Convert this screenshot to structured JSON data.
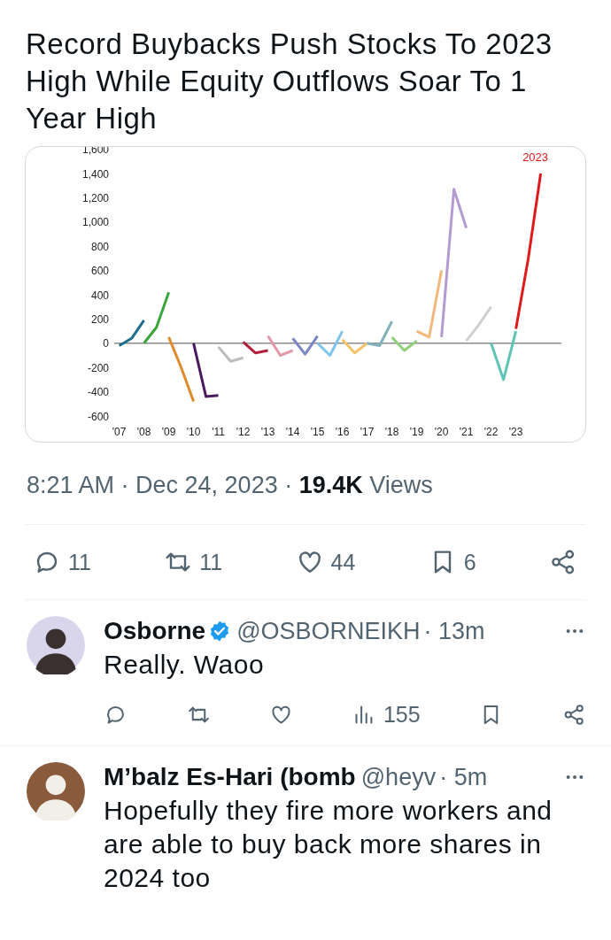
{
  "post": {
    "title": "Record Buybacks Push Stocks To 2023 High While Equity Outflows Soar To 1 Year High",
    "chart": {
      "chart_data": {
        "type": "line",
        "x": [
          2007,
          2007.5,
          2008,
          2008.5,
          2009,
          2009.5,
          2010,
          2010.5,
          2011,
          2011.5,
          2012,
          2012.5,
          2013,
          2013.5,
          2014,
          2014.5,
          2015,
          2015.5,
          2016,
          2016.5,
          2017,
          2017.5,
          2018,
          2018.5,
          2019,
          2019.5,
          2020,
          2020.5,
          2021,
          2021.5,
          2022,
          2022.5,
          2023,
          2023.5,
          2024
        ],
        "xlim": [
          2006.8,
          2024.8
        ],
        "xticks": [
          {
            "value": 2007,
            "label": "'07"
          },
          {
            "value": 2008,
            "label": "'08"
          },
          {
            "value": 2009,
            "label": "'09"
          },
          {
            "value": 2010,
            "label": "'10"
          },
          {
            "value": 2011,
            "label": "'11"
          },
          {
            "value": 2012,
            "label": "'12"
          },
          {
            "value": 2013,
            "label": "'13"
          },
          {
            "value": 2014,
            "label": "'14"
          },
          {
            "value": 2015,
            "label": "'15"
          },
          {
            "value": 2016,
            "label": "'16"
          },
          {
            "value": 2017,
            "label": "'17"
          },
          {
            "value": 2018,
            "label": "'18"
          },
          {
            "value": 2019,
            "label": "'19"
          },
          {
            "value": 2020,
            "label": "'20"
          },
          {
            "value": 2021,
            "label": "'21"
          },
          {
            "value": 2022,
            "label": "'22"
          },
          {
            "value": 2023,
            "label": "'23"
          }
        ],
        "ylim": [
          -600,
          1600
        ],
        "yticks": [
          {
            "value": 1600,
            "label": "1,600"
          },
          {
            "value": 1400,
            "label": "1,400"
          },
          {
            "value": 1200,
            "label": "1,200"
          },
          {
            "value": 1000,
            "label": "1,000"
          },
          800,
          600,
          400,
          200,
          0,
          -200,
          -400,
          -600
        ],
        "series": [
          {
            "color": "#1f6f8b",
            "values": [
              -20,
              40,
              190,
              null,
              null,
              null,
              null,
              null,
              null,
              null,
              null,
              null,
              null,
              null,
              null,
              null,
              null,
              null,
              null,
              null,
              null,
              null,
              null,
              null,
              null,
              null,
              null,
              null,
              null,
              null,
              null,
              null,
              null,
              null,
              null
            ]
          },
          {
            "color": "#3aa53a",
            "values": [
              null,
              null,
              0,
              130,
              420,
              null,
              null,
              null,
              null,
              null,
              null,
              null,
              null,
              null,
              null,
              null,
              null,
              null,
              null,
              null,
              null,
              null,
              null,
              null,
              null,
              null,
              null,
              null,
              null,
              null,
              null,
              null,
              null,
              null,
              null
            ]
          },
          {
            "color": "#e08a2c",
            "values": [
              null,
              null,
              null,
              null,
              50,
              -200,
              -480,
              null,
              null,
              null,
              null,
              null,
              null,
              null,
              null,
              null,
              null,
              null,
              null,
              null,
              null,
              null,
              null,
              null,
              null,
              null,
              null,
              null,
              null,
              null,
              null,
              null,
              null,
              null,
              null
            ]
          },
          {
            "color": "#4b1a5e",
            "values": [
              null,
              null,
              null,
              null,
              null,
              null,
              0,
              -440,
              -430,
              null,
              null,
              null,
              null,
              null,
              null,
              null,
              null,
              null,
              null,
              null,
              null,
              null,
              null,
              null,
              null,
              null,
              null,
              null,
              null,
              null,
              null,
              null,
              null,
              null,
              null
            ]
          },
          {
            "color": "#bdbdbd",
            "values": [
              null,
              null,
              null,
              null,
              null,
              null,
              null,
              null,
              -30,
              -150,
              -120,
              null,
              null,
              null,
              null,
              null,
              null,
              null,
              null,
              null,
              null,
              null,
              null,
              null,
              null,
              null,
              null,
              null,
              null,
              null,
              null,
              null,
              null,
              null,
              null
            ]
          },
          {
            "color": "#b0203a",
            "values": [
              null,
              null,
              null,
              null,
              null,
              null,
              null,
              null,
              null,
              null,
              10,
              -80,
              -60,
              null,
              null,
              null,
              null,
              null,
              null,
              null,
              null,
              null,
              null,
              null,
              null,
              null,
              null,
              null,
              null,
              null,
              null,
              null,
              null,
              null,
              null
            ]
          },
          {
            "color": "#e39aa8",
            "values": [
              null,
              null,
              null,
              null,
              null,
              null,
              null,
              null,
              null,
              null,
              null,
              null,
              60,
              -100,
              -60,
              null,
              null,
              null,
              null,
              null,
              null,
              null,
              null,
              null,
              null,
              null,
              null,
              null,
              null,
              null,
              null,
              null,
              null,
              null,
              null
            ]
          },
          {
            "color": "#7b86c2",
            "values": [
              null,
              null,
              null,
              null,
              null,
              null,
              null,
              null,
              null,
              null,
              null,
              null,
              null,
              null,
              40,
              -90,
              60,
              null,
              null,
              null,
              null,
              null,
              null,
              null,
              null,
              null,
              null,
              null,
              null,
              null,
              null,
              null,
              null,
              null,
              null
            ]
          },
          {
            "color": "#7fc4ea",
            "values": [
              null,
              null,
              null,
              null,
              null,
              null,
              null,
              null,
              null,
              null,
              null,
              null,
              null,
              null,
              null,
              null,
              0,
              -100,
              100,
              null,
              null,
              null,
              null,
              null,
              null,
              null,
              null,
              null,
              null,
              null,
              null,
              null,
              null,
              null,
              null
            ]
          },
          {
            "color": "#f2c46a",
            "values": [
              null,
              null,
              null,
              null,
              null,
              null,
              null,
              null,
              null,
              null,
              null,
              null,
              null,
              null,
              null,
              null,
              null,
              null,
              30,
              -80,
              0,
              null,
              null,
              null,
              null,
              null,
              null,
              null,
              null,
              null,
              null,
              null,
              null,
              null,
              null
            ]
          },
          {
            "color": "#7fb0ba",
            "values": [
              null,
              null,
              null,
              null,
              null,
              null,
              null,
              null,
              null,
              null,
              null,
              null,
              null,
              null,
              null,
              null,
              null,
              null,
              null,
              null,
              0,
              -20,
              180,
              null,
              null,
              null,
              null,
              null,
              null,
              null,
              null,
              null,
              null,
              null,
              null
            ]
          },
          {
            "color": "#8fce7a",
            "values": [
              null,
              null,
              null,
              null,
              null,
              null,
              null,
              null,
              null,
              null,
              null,
              null,
              null,
              null,
              null,
              null,
              null,
              null,
              null,
              null,
              null,
              null,
              50,
              -60,
              20,
              null,
              null,
              null,
              null,
              null,
              null,
              null,
              null,
              null,
              null
            ]
          },
          {
            "color": "#f2b77a",
            "values": [
              null,
              null,
              null,
              null,
              null,
              null,
              null,
              null,
              null,
              null,
              null,
              null,
              null,
              null,
              null,
              null,
              null,
              null,
              null,
              null,
              null,
              null,
              null,
              null,
              100,
              50,
              600,
              null,
              null,
              null,
              null,
              null,
              null,
              null,
              null
            ]
          },
          {
            "color": "#b39ad1",
            "values": [
              null,
              null,
              null,
              null,
              null,
              null,
              null,
              null,
              null,
              null,
              null,
              null,
              null,
              null,
              null,
              null,
              null,
              null,
              null,
              null,
              null,
              null,
              null,
              null,
              null,
              null,
              50,
              1270,
              950,
              null,
              null,
              null,
              null,
              null,
              null
            ]
          },
          {
            "color": "#cfcfcf",
            "values": [
              null,
              null,
              null,
              null,
              null,
              null,
              null,
              null,
              null,
              null,
              null,
              null,
              null,
              null,
              null,
              null,
              null,
              null,
              null,
              null,
              null,
              null,
              null,
              null,
              null,
              null,
              null,
              null,
              20,
              150,
              300,
              null,
              null,
              null,
              null
            ]
          },
          {
            "color": "#5fc4b4",
            "values": [
              null,
              null,
              null,
              null,
              null,
              null,
              null,
              null,
              null,
              null,
              null,
              null,
              null,
              null,
              null,
              null,
              null,
              null,
              null,
              null,
              null,
              null,
              null,
              null,
              null,
              null,
              null,
              null,
              null,
              null,
              0,
              -300,
              100,
              null,
              null
            ]
          },
          {
            "name": "2023",
            "color": "#e01a1a",
            "values": [
              null,
              null,
              null,
              null,
              null,
              null,
              null,
              null,
              null,
              null,
              null,
              null,
              null,
              null,
              null,
              null,
              null,
              null,
              null,
              null,
              null,
              null,
              null,
              null,
              null,
              null,
              null,
              null,
              null,
              null,
              null,
              null,
              120,
              700,
              1400
            ]
          }
        ]
      }
    },
    "meta": "8:21 AM · Dec 24, 2023 · **19.4K** Views",
    "actions": [
      {
        "kind": "reply",
        "count": "11"
      },
      {
        "kind": "repost",
        "count": "11"
      },
      {
        "kind": "like",
        "count": "44"
      },
      {
        "kind": "bookmark",
        "count": "6"
      },
      {
        "kind": "share"
      }
    ]
  },
  "replies": [
    {
      "name": "Osborne",
      "verified": true,
      "handle": "@OSBORNEIKH",
      "time": "· 13m",
      "text": "Really. Waoo",
      "actions": [
        {
          "kind": "reply"
        },
        {
          "kind": "repost"
        },
        {
          "kind": "like"
        },
        {
          "kind": "views",
          "count": "155"
        },
        {
          "kind": "bookmark"
        },
        {
          "kind": "share"
        }
      ]
    },
    {
      "name": "M’balz Es-Hari (bomb",
      "verified": false,
      "handle": "@heyv",
      "time": "· 5m",
      "text": "Hopefully they fire more workers and are able to buy back more shares in 2024 too"
    }
  ]
}
